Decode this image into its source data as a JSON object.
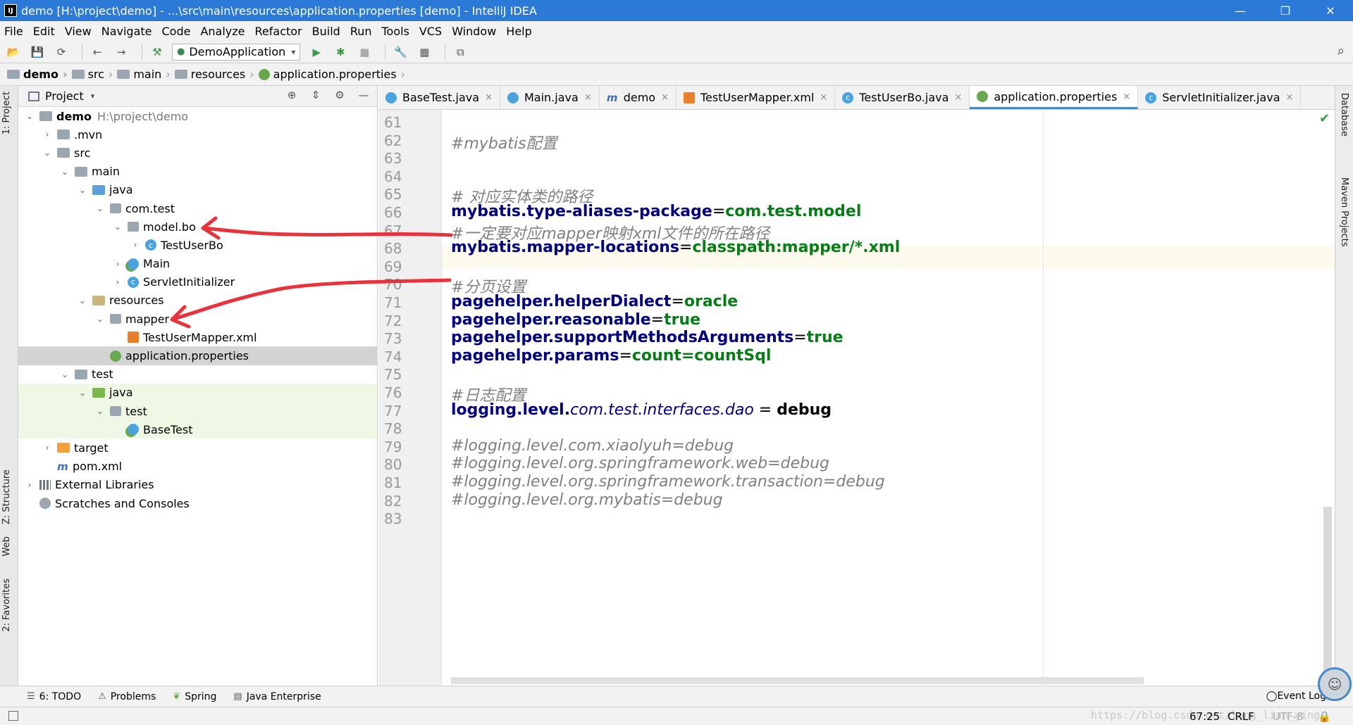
{
  "window": {
    "title": "demo [H:\\project\\demo] - ...\\src\\main\\resources\\application.properties [demo] - IntelliJ IDEA",
    "app_icon_text": "IJ",
    "minimize": "—",
    "restore": "❐",
    "close": "✕"
  },
  "menu": [
    "File",
    "Edit",
    "View",
    "Navigate",
    "Code",
    "Analyze",
    "Refactor",
    "Build",
    "Run",
    "Tools",
    "VCS",
    "Window",
    "Help"
  ],
  "toolbar": {
    "run_config": "DemoApplication"
  },
  "breadcrumb": [
    "demo",
    "src",
    "main",
    "resources",
    "application.properties"
  ],
  "left_stripe": {
    "project": "1: Project",
    "structure": "Z: Structure",
    "web": "Web",
    "favorites": "2: Favorites"
  },
  "right_stripe": {
    "database": "Database",
    "maven": "Maven Projects"
  },
  "project_panel": {
    "title": "Project",
    "tree": [
      {
        "label": "demo",
        "extra": "H:\\project\\demo",
        "indent": 0,
        "arrow": "open",
        "icon": "folder",
        "bold": true
      },
      {
        "label": ".mvn",
        "indent": 1,
        "arrow": "closed",
        "icon": "folder"
      },
      {
        "label": "src",
        "indent": 1,
        "arrow": "open",
        "icon": "folder"
      },
      {
        "label": "main",
        "indent": 2,
        "arrow": "open",
        "icon": "folder"
      },
      {
        "label": "java",
        "indent": 3,
        "arrow": "open",
        "icon": "folder-blue"
      },
      {
        "label": "com.test",
        "indent": 4,
        "arrow": "open",
        "icon": "pkg"
      },
      {
        "label": "model.bo",
        "indent": 5,
        "arrow": "open",
        "icon": "pkg"
      },
      {
        "label": "TestUserBo",
        "indent": 6,
        "arrow": "closed",
        "icon": "class"
      },
      {
        "label": "Main",
        "indent": 5,
        "arrow": "closed",
        "icon": "spring"
      },
      {
        "label": "ServletInitializer",
        "indent": 5,
        "arrow": "closed",
        "icon": "class"
      },
      {
        "label": "resources",
        "indent": 3,
        "arrow": "open",
        "icon": "folder-res"
      },
      {
        "label": "mapper",
        "indent": 4,
        "arrow": "open",
        "icon": "pkg"
      },
      {
        "label": "TestUserMapper.xml",
        "indent": 5,
        "arrow": "none",
        "icon": "xml"
      },
      {
        "label": "application.properties",
        "indent": 4,
        "arrow": "none",
        "icon": "props",
        "selected": true
      },
      {
        "label": "test",
        "indent": 2,
        "arrow": "open",
        "icon": "folder"
      },
      {
        "label": "java",
        "indent": 3,
        "arrow": "open",
        "icon": "folder-green",
        "green": true
      },
      {
        "label": "test",
        "indent": 4,
        "arrow": "open",
        "icon": "pkg",
        "green": true
      },
      {
        "label": "BaseTest",
        "indent": 5,
        "arrow": "none",
        "icon": "spring",
        "green": true
      },
      {
        "label": "target",
        "indent": 1,
        "arrow": "closed",
        "icon": "folder-orange"
      },
      {
        "label": "pom.xml",
        "indent": 1,
        "arrow": "none",
        "icon": "maven"
      },
      {
        "label": "External Libraries",
        "indent": 0,
        "arrow": "closed",
        "icon": "libs"
      },
      {
        "label": "Scratches and Consoles",
        "indent": 0,
        "arrow": "none",
        "icon": "scratch"
      }
    ]
  },
  "editor_tabs": [
    {
      "label": "BaseTest.java",
      "icon": "spring"
    },
    {
      "label": "Main.java",
      "icon": "spring"
    },
    {
      "label": "demo",
      "icon": "m"
    },
    {
      "label": "TestUserMapper.xml",
      "icon": "xml"
    },
    {
      "label": "TestUserBo.java",
      "icon": "class"
    },
    {
      "label": "application.properties",
      "icon": "props",
      "active": true
    },
    {
      "label": "ServletInitializer.java",
      "icon": "class"
    }
  ],
  "editor": {
    "lines": [
      {
        "n": "61",
        "parts": []
      },
      {
        "n": "62",
        "parts": [
          {
            "t": "#mybatis配置",
            "c": "c-comment"
          }
        ]
      },
      {
        "n": "63",
        "parts": []
      },
      {
        "n": "64",
        "parts": []
      },
      {
        "n": "65",
        "parts": [
          {
            "t": "# 对应实体类的路径",
            "c": "c-comment"
          }
        ]
      },
      {
        "n": "66",
        "parts": [
          {
            "t": "mybatis.type-aliases-package",
            "c": "c-key"
          },
          {
            "t": "=",
            "c": "c-eq"
          },
          {
            "t": "com.test.model",
            "c": "c-val"
          }
        ]
      },
      {
        "n": "67",
        "parts": [
          {
            "t": "#一定要对应mapper映射xml文件的所在路径",
            "c": "c-comment"
          }
        ]
      },
      {
        "n": "68",
        "parts": [
          {
            "t": "mybatis.mapper-locations",
            "c": "c-key"
          },
          {
            "t": "=",
            "c": "c-eq"
          },
          {
            "t": "classpath:mapper/*.xml",
            "c": "c-val"
          }
        ]
      },
      {
        "n": "69",
        "parts": []
      },
      {
        "n": "70",
        "parts": [
          {
            "t": "#分页设置",
            "c": "c-comment"
          }
        ]
      },
      {
        "n": "71",
        "parts": [
          {
            "t": "pagehelper.helperDialect",
            "c": "c-key"
          },
          {
            "t": "=",
            "c": "c-eq"
          },
          {
            "t": "oracle",
            "c": "c-val"
          }
        ]
      },
      {
        "n": "72",
        "parts": [
          {
            "t": "pagehelper.reasonable",
            "c": "c-key"
          },
          {
            "t": "=",
            "c": "c-eq"
          },
          {
            "t": "true",
            "c": "c-val"
          }
        ]
      },
      {
        "n": "73",
        "parts": [
          {
            "t": "pagehelper.supportMethodsArguments",
            "c": "c-key"
          },
          {
            "t": "=",
            "c": "c-eq"
          },
          {
            "t": "true",
            "c": "c-val"
          }
        ]
      },
      {
        "n": "74",
        "parts": [
          {
            "t": "pagehelper.params",
            "c": "c-key"
          },
          {
            "t": "=",
            "c": "c-eq"
          },
          {
            "t": "count=countSql",
            "c": "c-val"
          }
        ]
      },
      {
        "n": "75",
        "parts": []
      },
      {
        "n": "76",
        "parts": [
          {
            "t": "#日志配置",
            "c": "c-comment"
          }
        ]
      },
      {
        "n": "77",
        "parts": [
          {
            "t": "logging.level.",
            "c": "c-key"
          },
          {
            "t": "com.test.interfaces.dao",
            "c": "c-italic-key"
          },
          {
            "t": " = ",
            "c": "c-eq"
          },
          {
            "t": "debug",
            "c": "c-plain-bold"
          }
        ]
      },
      {
        "n": "78",
        "parts": []
      },
      {
        "n": "79",
        "parts": [
          {
            "t": "#logging.level.com.xiaolyuh=debug",
            "c": "c-comment"
          }
        ]
      },
      {
        "n": "80",
        "parts": [
          {
            "t": "#logging.level.org.springframework.web=debug",
            "c": "c-comment"
          }
        ]
      },
      {
        "n": "81",
        "parts": [
          {
            "t": "#logging.level.org.springframework.transaction=debug",
            "c": "c-comment"
          }
        ]
      },
      {
        "n": "82",
        "parts": [
          {
            "t": "#logging.level.org.mybatis=debug",
            "c": "c-comment"
          }
        ]
      },
      {
        "n": "83",
        "parts": []
      }
    ]
  },
  "bottom_tools": {
    "todo": "6: TODO",
    "problems": "Problems",
    "spring": "Spring",
    "java_enterprise": "Java Enterprise",
    "event_log": "Event Log"
  },
  "status": {
    "position": "67:25",
    "line_sep": "CRLF",
    "encoding": "UTF-8",
    "watermark": "https://blog.csdn.net/lang_lian_ying"
  },
  "colors": {
    "accent": "#2b7ad8",
    "annotation": "#e8323c"
  }
}
